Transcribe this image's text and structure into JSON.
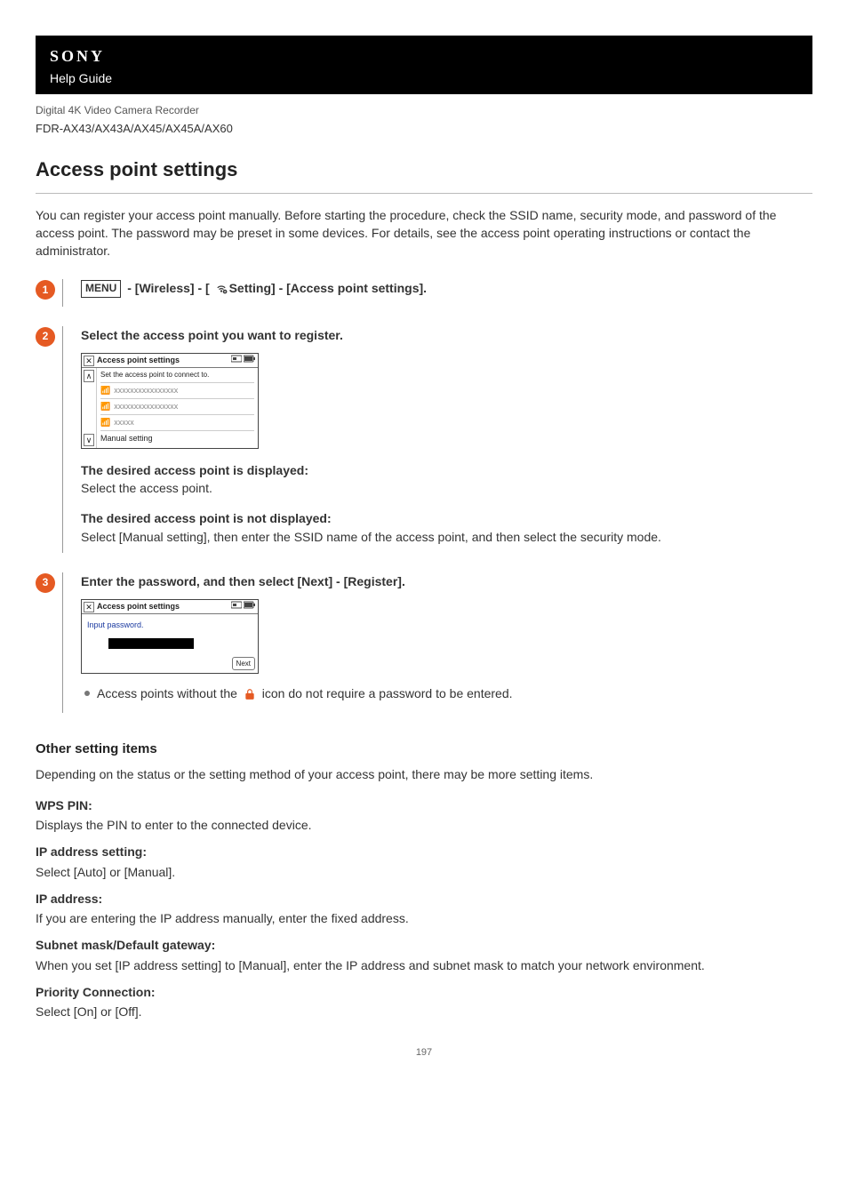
{
  "header": {
    "brand": "SONY",
    "subtitle": "Help Guide",
    "product_line": "Digital 4K Video Camera Recorder",
    "model": "FDR-AX43/AX43A/AX45/AX45A/AX60"
  },
  "title": "Access point settings",
  "intro": "You can register your access point manually. Before starting the procedure, check the SSID name, security mode, and password of the access point. The password may be preset in some devices. For details, see the access point operating instructions or contact the administrator.",
  "steps": {
    "s1": {
      "num": "1",
      "menu_label": "MENU",
      "heading_rest": " - [Wireless] - [ ",
      "heading_after_icon": "Setting] - [Access point settings]."
    },
    "s2": {
      "num": "2",
      "heading": "Select the access point you want to register.",
      "lcd": {
        "close": "✕",
        "title": "Access point settings",
        "instr": "Set the access point to connect to.",
        "row1": "xxxxxxxxxxxxxxxx",
        "row2": "xxxxxxxxxxxxxxxx",
        "row3": "xxxxx",
        "manual": "Manual setting",
        "arrow_up": "∧",
        "arrow_down": "∨"
      },
      "disp_title": "The desired access point is displayed:",
      "disp_text": "Select the access point.",
      "notdisp_title": "The desired access point is not displayed:",
      "notdisp_text": "Select [Manual setting], then enter the SSID name of the access point, and then select the security mode."
    },
    "s3": {
      "num": "3",
      "heading": "Enter the password, and then select [Next] - [Register].",
      "lcd": {
        "close": "✕",
        "title": "Access point settings",
        "instr": "Input password.",
        "next": "Next"
      },
      "bullet_before": "Access points without the ",
      "bullet_after": " icon do not require a password to be entered."
    }
  },
  "other": {
    "heading": "Other setting items",
    "desc": "Depending on the status or the setting method of your access point, there may be more setting items.",
    "items": {
      "wps_pin_t": "WPS PIN:",
      "wps_pin_d": "Displays the PIN to enter to the connected device.",
      "ip_set_t": "IP address setting:",
      "ip_set_d": "Select [Auto] or [Manual].",
      "ip_addr_t": "IP address:",
      "ip_addr_d": "If you are entering the IP address manually, enter the fixed address.",
      "subnet_t": "Subnet mask/Default gateway:",
      "subnet_d": "When you set [IP address setting] to [Manual], enter the IP address and subnet mask to match your network environment.",
      "prio_t": "Priority Connection:",
      "prio_d": "Select [On] or [Off]."
    }
  },
  "page_number": "197"
}
